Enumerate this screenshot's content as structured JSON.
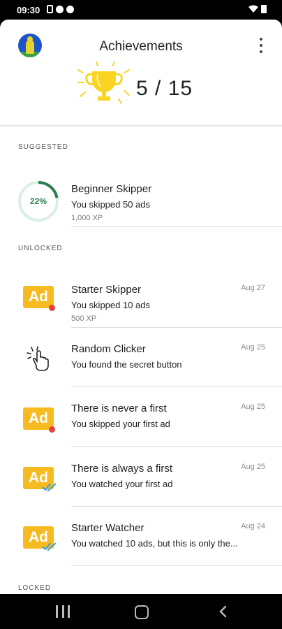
{
  "status_bar": {
    "time": "09:30"
  },
  "header": {
    "title": "Achievements",
    "achieved": "5 / 15"
  },
  "suggested": {
    "label": "SUGGESTED",
    "item": {
      "title": "Beginner Skipper",
      "desc": "You skipped 50 ads",
      "xp": "1,000 XP",
      "progress_text": "22%",
      "progress": 0.22
    }
  },
  "unlocked": {
    "label": "UNLOCKED",
    "items": [
      {
        "title": "Starter Skipper",
        "desc": "You skipped 10 ads",
        "xp": "500 XP",
        "date": "Aug 27",
        "icon": "ad-skip-icon"
      },
      {
        "title": "Random Clicker",
        "desc": "You found the secret button",
        "date": "Aug 25",
        "icon": "tap-hand-icon"
      },
      {
        "title": "There is never a first",
        "desc": "You skipped your first ad",
        "date": "Aug 25",
        "icon": "ad-skip-icon"
      },
      {
        "title": "There is always a first",
        "desc": "You watched your first ad",
        "date": "Aug 25",
        "icon": "ad-watched-icon"
      },
      {
        "title": "Starter Watcher",
        "desc": "You watched 10 ads, but this is only the...",
        "date": "Aug 24",
        "icon": "ad-watched-icon"
      }
    ]
  },
  "locked": {
    "label": "LOCKED"
  },
  "colors": {
    "accent_green": "#2e7d4f",
    "ad_yellow": "#f6bb21",
    "trophy_yellow": "#f9d423"
  }
}
